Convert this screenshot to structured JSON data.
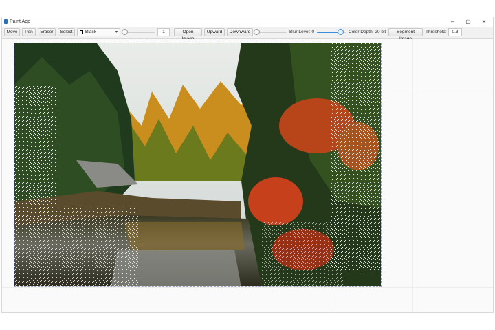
{
  "window": {
    "title": "Paint App",
    "minimize": "–",
    "maximize": "▢",
    "close": "✕"
  },
  "toolbar": {
    "move": "Move",
    "pen": "Pen",
    "eraser": "Eraser",
    "select": "Select",
    "color": {
      "label": "Black",
      "value": "#000000"
    },
    "size_slider": {
      "value_fraction": 0.0
    },
    "size_value": "1",
    "open_image": "Open Image",
    "upward": "Upward",
    "downward": "Downward",
    "blur_slider": {
      "value_fraction": 0.0
    },
    "blur_label": "Blur Level: 0",
    "depth_slider": {
      "value_fraction": 1.0
    },
    "color_depth_label": "Color Depth: 20 bit",
    "segment_image": "Segment Image",
    "threshold_label": "Threshold:",
    "threshold_value": "0.3"
  },
  "canvas": {
    "image": "autumn-river-landscape"
  },
  "colors": {
    "accent": "#3b8edb",
    "toolbar_bg": "#f1f1f1",
    "canvas_bg": "#fafafa"
  }
}
